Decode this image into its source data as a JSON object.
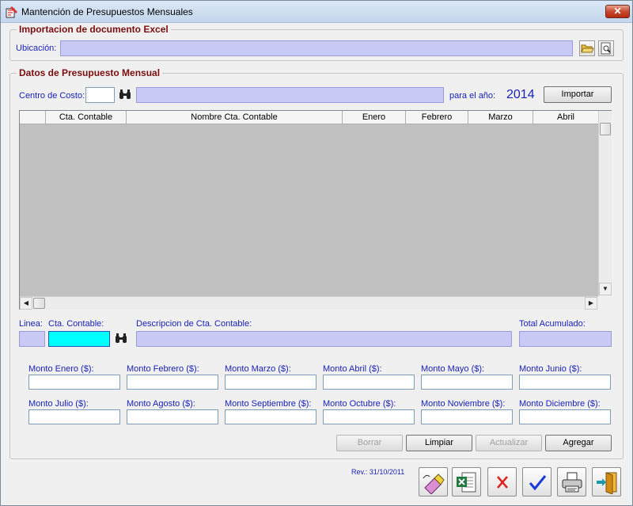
{
  "window": {
    "title": "Mantención de Presupuestos Mensuales",
    "close_label": "✕"
  },
  "import_group": {
    "legend": "Importacion de documento Excel",
    "ubicacion_label": "Ubicación:",
    "ubicacion_value": ""
  },
  "data_group": {
    "legend": "Datos de Presupuesto Mensual",
    "centro_label": "Centro de Costo:",
    "centro_value": "",
    "centro_desc": "",
    "year_label": "para el año:",
    "year_value": "2014",
    "importar": "Importar"
  },
  "grid": {
    "columns": [
      "",
      "Cta. Contable",
      "Nombre Cta. Contable",
      "Enero",
      "Febrero",
      "Marzo",
      "Abril"
    ]
  },
  "detail": {
    "linea_label": "Linea:",
    "cta_label": "Cta. Contable:",
    "desc_label": "Descripcion de Cta. Contable:",
    "total_label": "Total Acumulado:"
  },
  "montos": [
    "Monto Enero ($):",
    "Monto Febrero ($):",
    "Monto Marzo ($):",
    "Monto Abril ($):",
    "Monto Mayo ($):",
    "Monto Junio ($):",
    "Monto Julio ($):",
    "Monto Agosto ($):",
    "Monto Septiembre ($):",
    "Monto Octubre ($):",
    "Monto Noviembre ($):",
    "Monto Diciembre ($):"
  ],
  "actions": {
    "borrar": "Borrar",
    "limpiar": "Limpiar",
    "actualizar": "Actualizar",
    "agregar": "Agregar"
  },
  "footer": {
    "rev": "Rev.: 31/10/2011"
  },
  "colors": {
    "accent_label": "#1a22b8",
    "legend": "#7a0e0e",
    "lavender_field": "#c9c9f5",
    "cyan_field": "#00ffff"
  },
  "toolbar_icons": [
    "eraser-icon",
    "excel-export-icon",
    "cancel-icon",
    "accept-icon",
    "print-icon",
    "exit-door-icon"
  ]
}
